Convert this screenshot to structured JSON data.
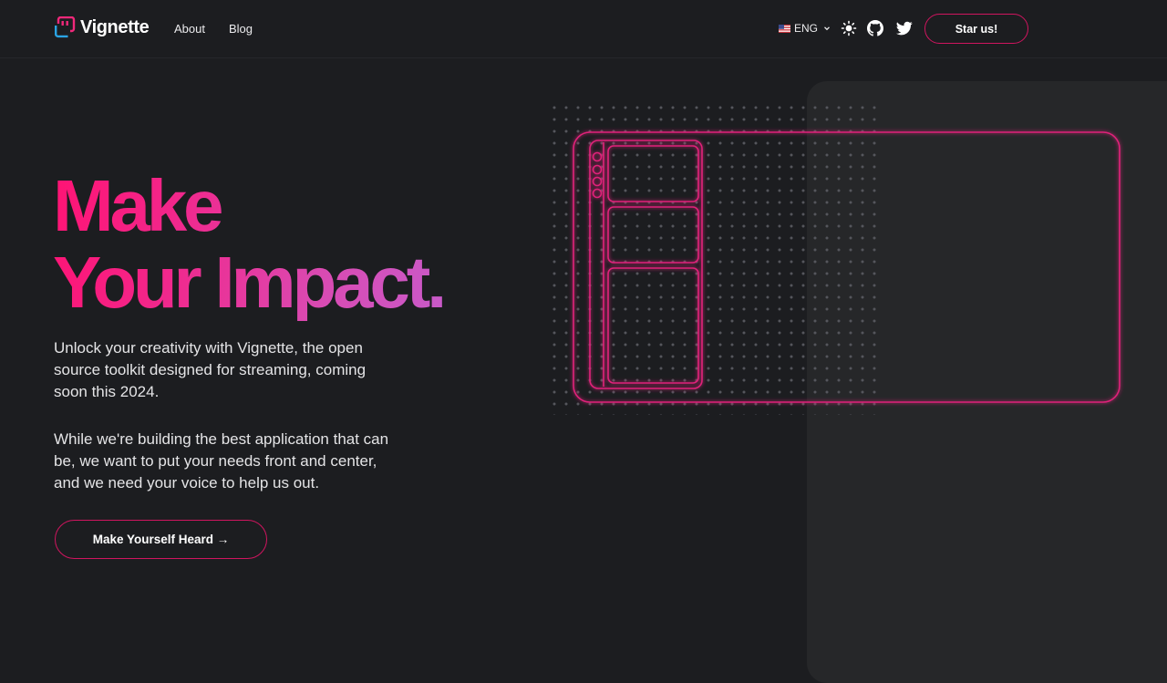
{
  "header": {
    "brand": "Vignette",
    "nav": [
      {
        "label": "About"
      },
      {
        "label": "Blog"
      }
    ],
    "language": "ENG",
    "star_label": "Star us!",
    "icons": [
      "logo-mark",
      "us-flag-icon",
      "chevron-down-icon",
      "sun-icon",
      "github-icon",
      "twitter-icon"
    ]
  },
  "hero": {
    "title_line1": "Make",
    "title_line2": "Your Impact.",
    "paragraph1": "Unlock your creativity with Vignette, the open source toolkit designed for streaming, coming soon this 2024.",
    "paragraph2": "While we're building the best application that can be, we want to put your needs front and center, and we need your voice to help us out.",
    "cta_label": "Make Yourself Heard →"
  },
  "colors": {
    "background": "#1c1d20",
    "panel": "#262729",
    "accent": "#d0155f",
    "outline_pink": "#e0207a",
    "gradient_start": "#ff1374",
    "gradient_end": "#c85ac9",
    "logo_blue": "#2aa4e4",
    "logo_pink": "#f0287a"
  }
}
